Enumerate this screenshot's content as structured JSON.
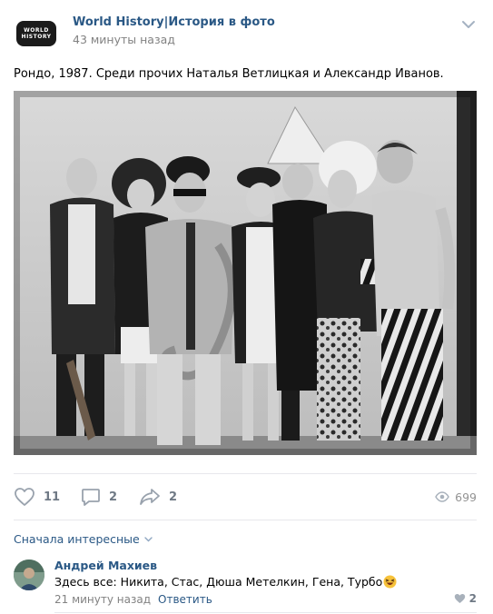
{
  "post": {
    "group_name": "World History|История в фото",
    "time": "43 минуты назад",
    "avatar_text_1": "WORLD",
    "avatar_text_2": "HISTORY",
    "text": "Рондо, 1987. Среди прочих Наталья Ветлицкая и Александр Иванов.",
    "photo_icon": "black-and-white-group-photo"
  },
  "actions": {
    "likes": "11",
    "comments": "2",
    "shares": "2",
    "views": "699",
    "like_icon": "heart-icon",
    "comment_icon": "comment-icon",
    "share_icon": "share-icon",
    "views_icon": "eye-icon"
  },
  "comments_section": {
    "sort_label": "Сначала интересные"
  },
  "comment": {
    "author": "Андрей Махиев",
    "text": "Здесь все: Никита, Стас, Дюша Метелкин, Гена, Турбо",
    "emoji": "laughing-face-emoji",
    "time": "21 минуту назад",
    "reply_label": "Ответить",
    "likes": "2"
  },
  "colors": {
    "link": "#2a5885",
    "muted": "#828282",
    "icon": "#6f7985",
    "divider": "#e7e8ec"
  }
}
